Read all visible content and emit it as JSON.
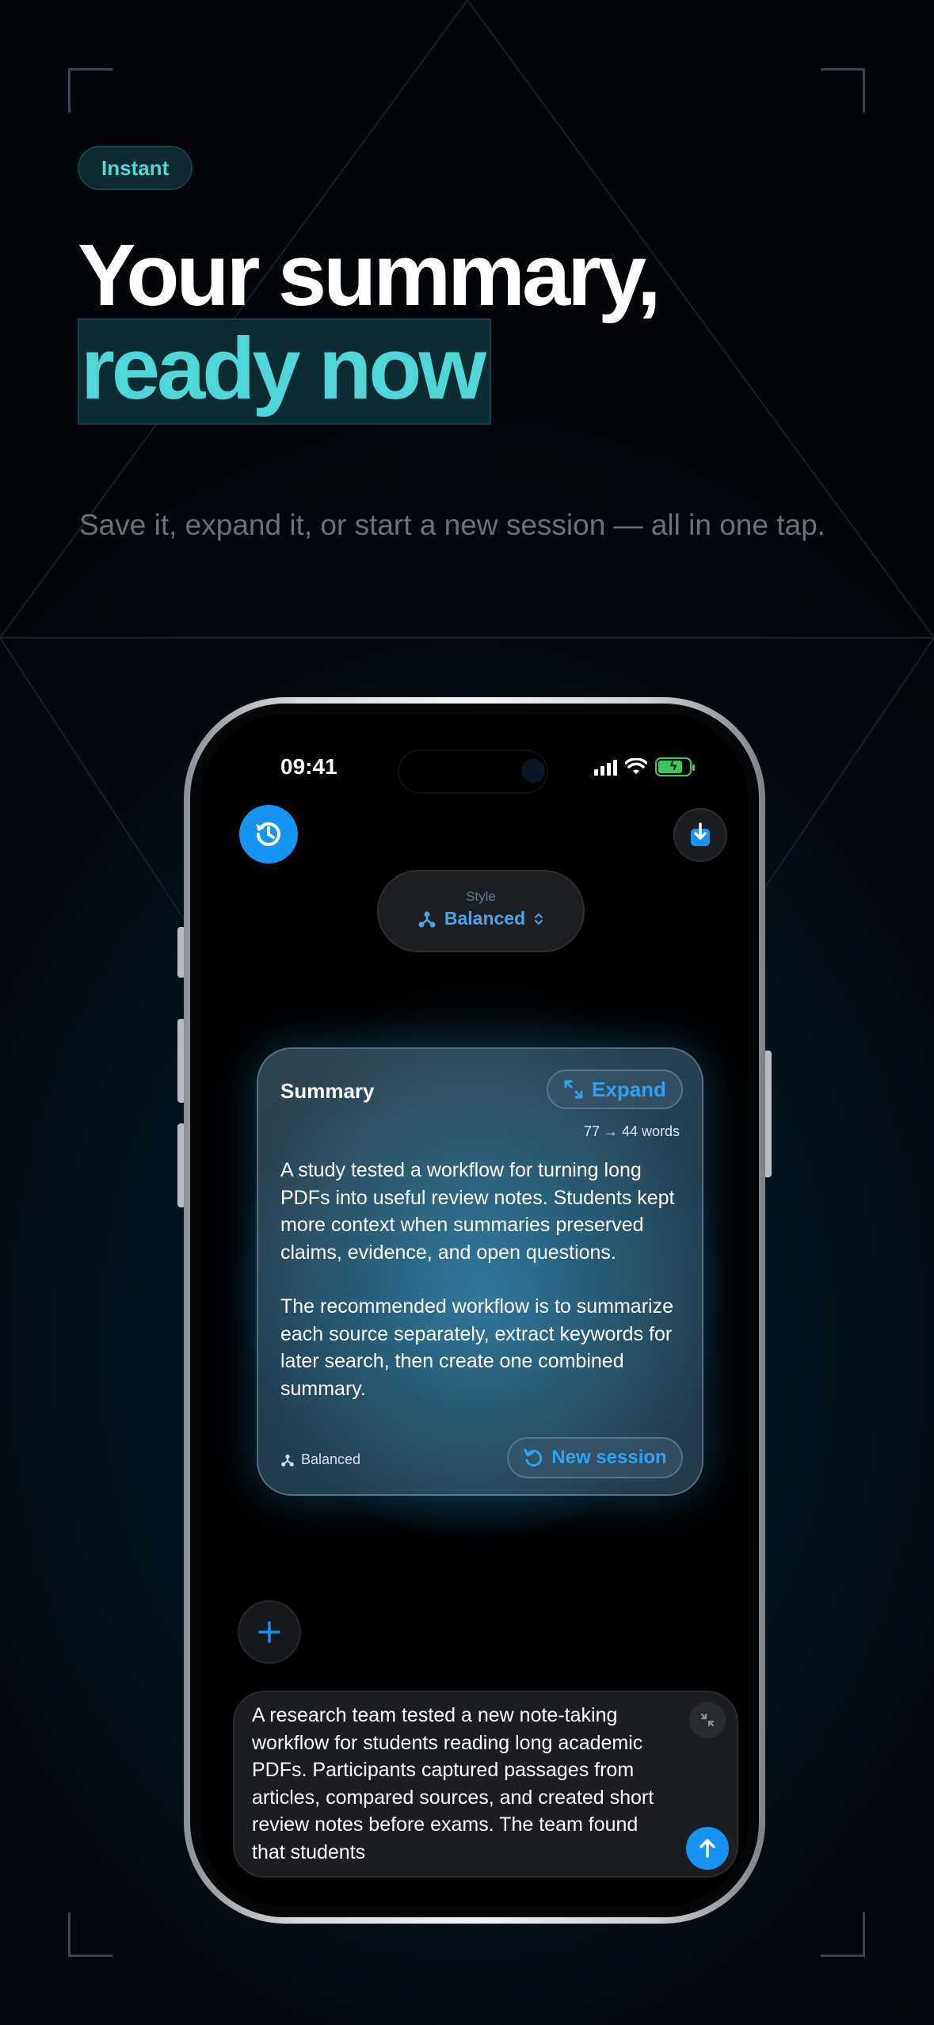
{
  "badge": "Instant",
  "headline": {
    "line1": "Your summary,",
    "line2": "ready now"
  },
  "subtitle": "Save it, expand it, or start a new session — all in one tap.",
  "colors": {
    "accent_teal": "#4fd6d8",
    "accent_blue": "#1793f3",
    "battery_green": "#3cc75a"
  },
  "status_bar": {
    "time": "09:41",
    "icons": [
      "cellular-signal-icon",
      "wifi-icon",
      "battery-charging-icon"
    ]
  },
  "toolbar": {
    "history_icon": "history-icon",
    "download_icon": "download-icon"
  },
  "style_picker": {
    "label": "Style",
    "value": "Balanced"
  },
  "summary_card": {
    "title": "Summary",
    "expand_label": "Expand",
    "word_count": "77 → 44 words",
    "paragraphs": [
      "A study tested a workflow for turning long PDFs into useful review notes. Students kept more context when summaries preserved claims, evidence, and open questions.",
      "The recommended workflow is to summarize each source separately, extract keywords for later search, then create one combined summary."
    ],
    "footer_style": "Balanced",
    "new_session_label": "New session"
  },
  "composer": {
    "text": "A research team tested a new note-taking workflow for students reading long academic PDFs. Participants captured passages from articles, compared sources, and created short review notes before exams. The team found that students"
  }
}
